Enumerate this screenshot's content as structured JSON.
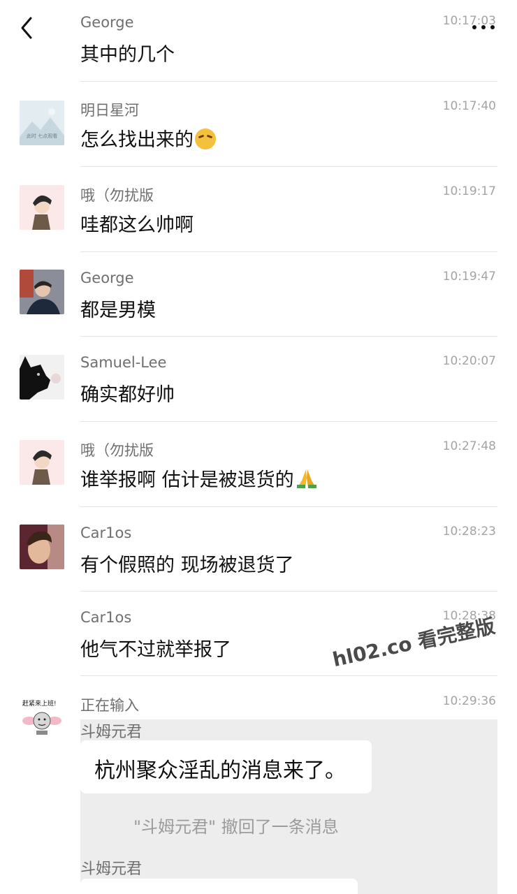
{
  "header": {
    "back_icon": "chevron-left-icon",
    "more_icon": "more-dots-icon"
  },
  "messages": [
    {
      "name": "George",
      "time": "10:17:03",
      "text": "其中的几个",
      "avatar": "none"
    },
    {
      "name": "明日星河",
      "time": "10:17:40",
      "text": "怎么找出来的",
      "emoji": "laughing-crying-emoji",
      "avatar": "landscape-placeholder",
      "avatar_text": "此时 七点观看"
    },
    {
      "name": "哦（勿扰版",
      "time": "10:19:17",
      "text": "哇都这么帅啊",
      "avatar": "cartoon-boy"
    },
    {
      "name": "George",
      "time": "10:19:47",
      "text": "都是男模",
      "avatar": "photo-man"
    },
    {
      "name": "Samuel-Lee",
      "time": "10:20:07",
      "text": "确实都好帅",
      "avatar": "black-cat"
    },
    {
      "name": "哦（勿扰版",
      "time": "10:27:48",
      "text": "谁举报啊 估计是被退货的",
      "emoji": "folded-hands-emoji",
      "avatar": "cartoon-boy"
    },
    {
      "name": "Car1os",
      "time": "10:28:23",
      "text": "有个假照的 现场被退货了",
      "avatar": "photo-man-2"
    },
    {
      "name": "Car1os",
      "time": "10:28:38",
      "text": "他气不过就举报了",
      "avatar": "none"
    },
    {
      "name": "正在输入",
      "time": "10:29:36",
      "text": "",
      "avatar": "meme-sticker",
      "avatar_text": "赶紧来上班!"
    }
  ],
  "watermark": "hl02.co 看完整版",
  "screenshot": {
    "sender1": "斗姆元君",
    "bubble_text": "杭州聚众淫乱的消息来了。",
    "recall_notice": "\"斗姆元君\" 撤回了一条消息",
    "sender2": "斗姆元君"
  },
  "colors": {
    "name": "#6f6f6f",
    "time": "#a4a4a4",
    "divider": "#e3e3e3",
    "screenshot_bg": "#ededed"
  }
}
